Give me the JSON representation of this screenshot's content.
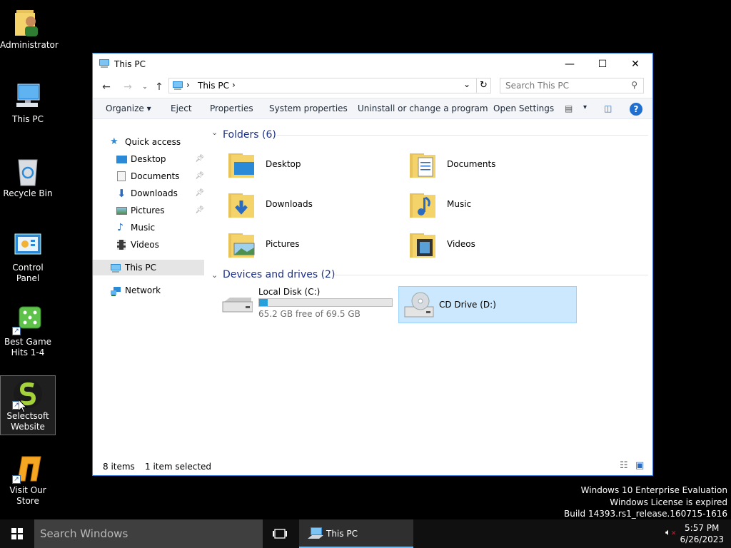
{
  "desktop": {
    "icons": [
      {
        "label": "Administrator"
      },
      {
        "label": "This PC"
      },
      {
        "label": "Recycle Bin"
      },
      {
        "label": "Control Panel"
      },
      {
        "label": "Best Game Hits 1-4"
      },
      {
        "label": "Selectsoft Website"
      },
      {
        "label": "Visit Our Store"
      }
    ]
  },
  "window": {
    "title": "This PC",
    "address": {
      "crumb": "This PC"
    },
    "search": {
      "placeholder": "Search This PC"
    },
    "commands": [
      "Organize",
      "Eject",
      "Properties",
      "System properties",
      "Uninstall or change a program",
      "Open Settings"
    ],
    "nav": {
      "quick_access": "Quick access",
      "items": [
        "Desktop",
        "Documents",
        "Downloads",
        "Pictures",
        "Music",
        "Videos"
      ],
      "this_pc": "This PC",
      "network": "Network"
    },
    "folders_header": "Folders (6)",
    "folders": [
      "Desktop",
      "Documents",
      "Downloads",
      "Music",
      "Pictures",
      "Videos"
    ],
    "devices_header": "Devices and drives (2)",
    "drives": [
      {
        "name": "Local Disk (C:)",
        "free": "65.2 GB free of 69.5 GB",
        "used_fraction": 0.062
      },
      {
        "name": "CD Drive (D:)"
      }
    ],
    "status": {
      "items": "8 items",
      "selected": "1 item selected"
    }
  },
  "license": {
    "line1": "Windows 10 Enterprise Evaluation",
    "line2": "Windows License is expired",
    "line3": "Build 14393.rs1_release.160715-1616"
  },
  "taskbar": {
    "search_placeholder": "Search Windows",
    "app_label": "This PC",
    "time": "5:57 PM",
    "date": "6/26/2023"
  },
  "colors": {
    "accent": "#2b79d6",
    "selection": "#cce8ff",
    "header": "#1e3287",
    "drive_fill": "#26a0da"
  }
}
